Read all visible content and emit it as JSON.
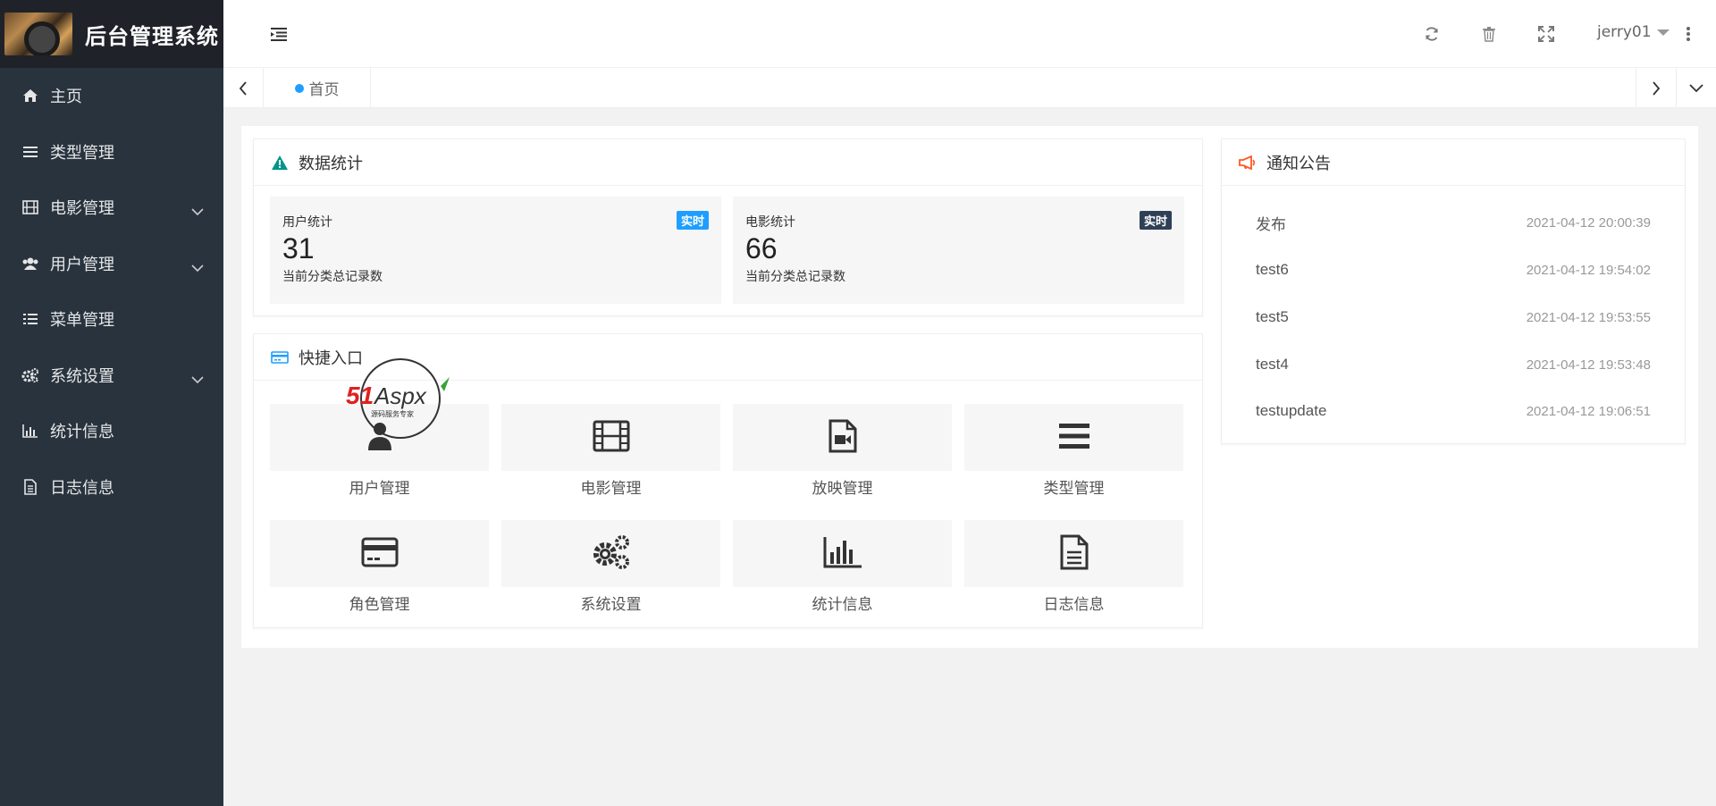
{
  "app": {
    "title": "后台管理系统"
  },
  "sidebar": {
    "items": [
      {
        "label": "主页",
        "icon": "home-icon",
        "expandable": false
      },
      {
        "label": "类型管理",
        "icon": "bars-icon",
        "expandable": false
      },
      {
        "label": "电影管理",
        "icon": "film-icon",
        "expandable": true
      },
      {
        "label": "用户管理",
        "icon": "users-icon",
        "expandable": true
      },
      {
        "label": "菜单管理",
        "icon": "list-icon",
        "expandable": false
      },
      {
        "label": "系统设置",
        "icon": "cogs-icon",
        "expandable": true
      },
      {
        "label": "统计信息",
        "icon": "bar-chart-icon",
        "expandable": false
      },
      {
        "label": "日志信息",
        "icon": "file-text-icon",
        "expandable": false
      }
    ]
  },
  "header": {
    "username": "jerry01",
    "icons": [
      "refresh-icon",
      "trash-icon",
      "fullscreen-icon",
      "more-vertical-icon"
    ]
  },
  "tabs": [
    {
      "label": "首页",
      "active": true
    }
  ],
  "stats_card": {
    "title": "数据统计",
    "items": [
      {
        "title": "用户统计",
        "value": "31",
        "desc": "当前分类总记录数",
        "badge": "实时",
        "badge_color": "#1e9fff"
      },
      {
        "title": "电影统计",
        "value": "66",
        "desc": "当前分类总记录数",
        "badge": "实时",
        "badge_color": "#2f4056"
      }
    ]
  },
  "quick_card": {
    "title": "快捷入口",
    "items": [
      {
        "label": "用户管理",
        "icon": "user-icon"
      },
      {
        "label": "电影管理",
        "icon": "film-icon"
      },
      {
        "label": "放映管理",
        "icon": "file-video-icon"
      },
      {
        "label": "类型管理",
        "icon": "bars-icon"
      },
      {
        "label": "角色管理",
        "icon": "credit-card-icon"
      },
      {
        "label": "系统设置",
        "icon": "cogs-icon"
      },
      {
        "label": "统计信息",
        "icon": "bar-chart-icon"
      },
      {
        "label": "日志信息",
        "icon": "file-text-icon"
      }
    ]
  },
  "notice_card": {
    "title": "通知公告",
    "items": [
      {
        "title": "发布",
        "time": "2021-04-12 20:00:39"
      },
      {
        "title": "test6",
        "time": "2021-04-12 19:54:02"
      },
      {
        "title": "test5",
        "time": "2021-04-12 19:53:55"
      },
      {
        "title": "test4",
        "time": "2021-04-12 19:53:48"
      },
      {
        "title": "testupdate",
        "time": "2021-04-12 19:06:51"
      }
    ]
  },
  "watermark": {
    "text": "51Aspx",
    "subtext": "源码服务专家"
  },
  "colors": {
    "sidebar_bg": "#28333e",
    "logo_bg": "#20222a",
    "accent_blue": "#1e9fff",
    "accent_dark": "#2f4056",
    "stats_icon": "#009688",
    "notice_icon": "#ff5722"
  }
}
